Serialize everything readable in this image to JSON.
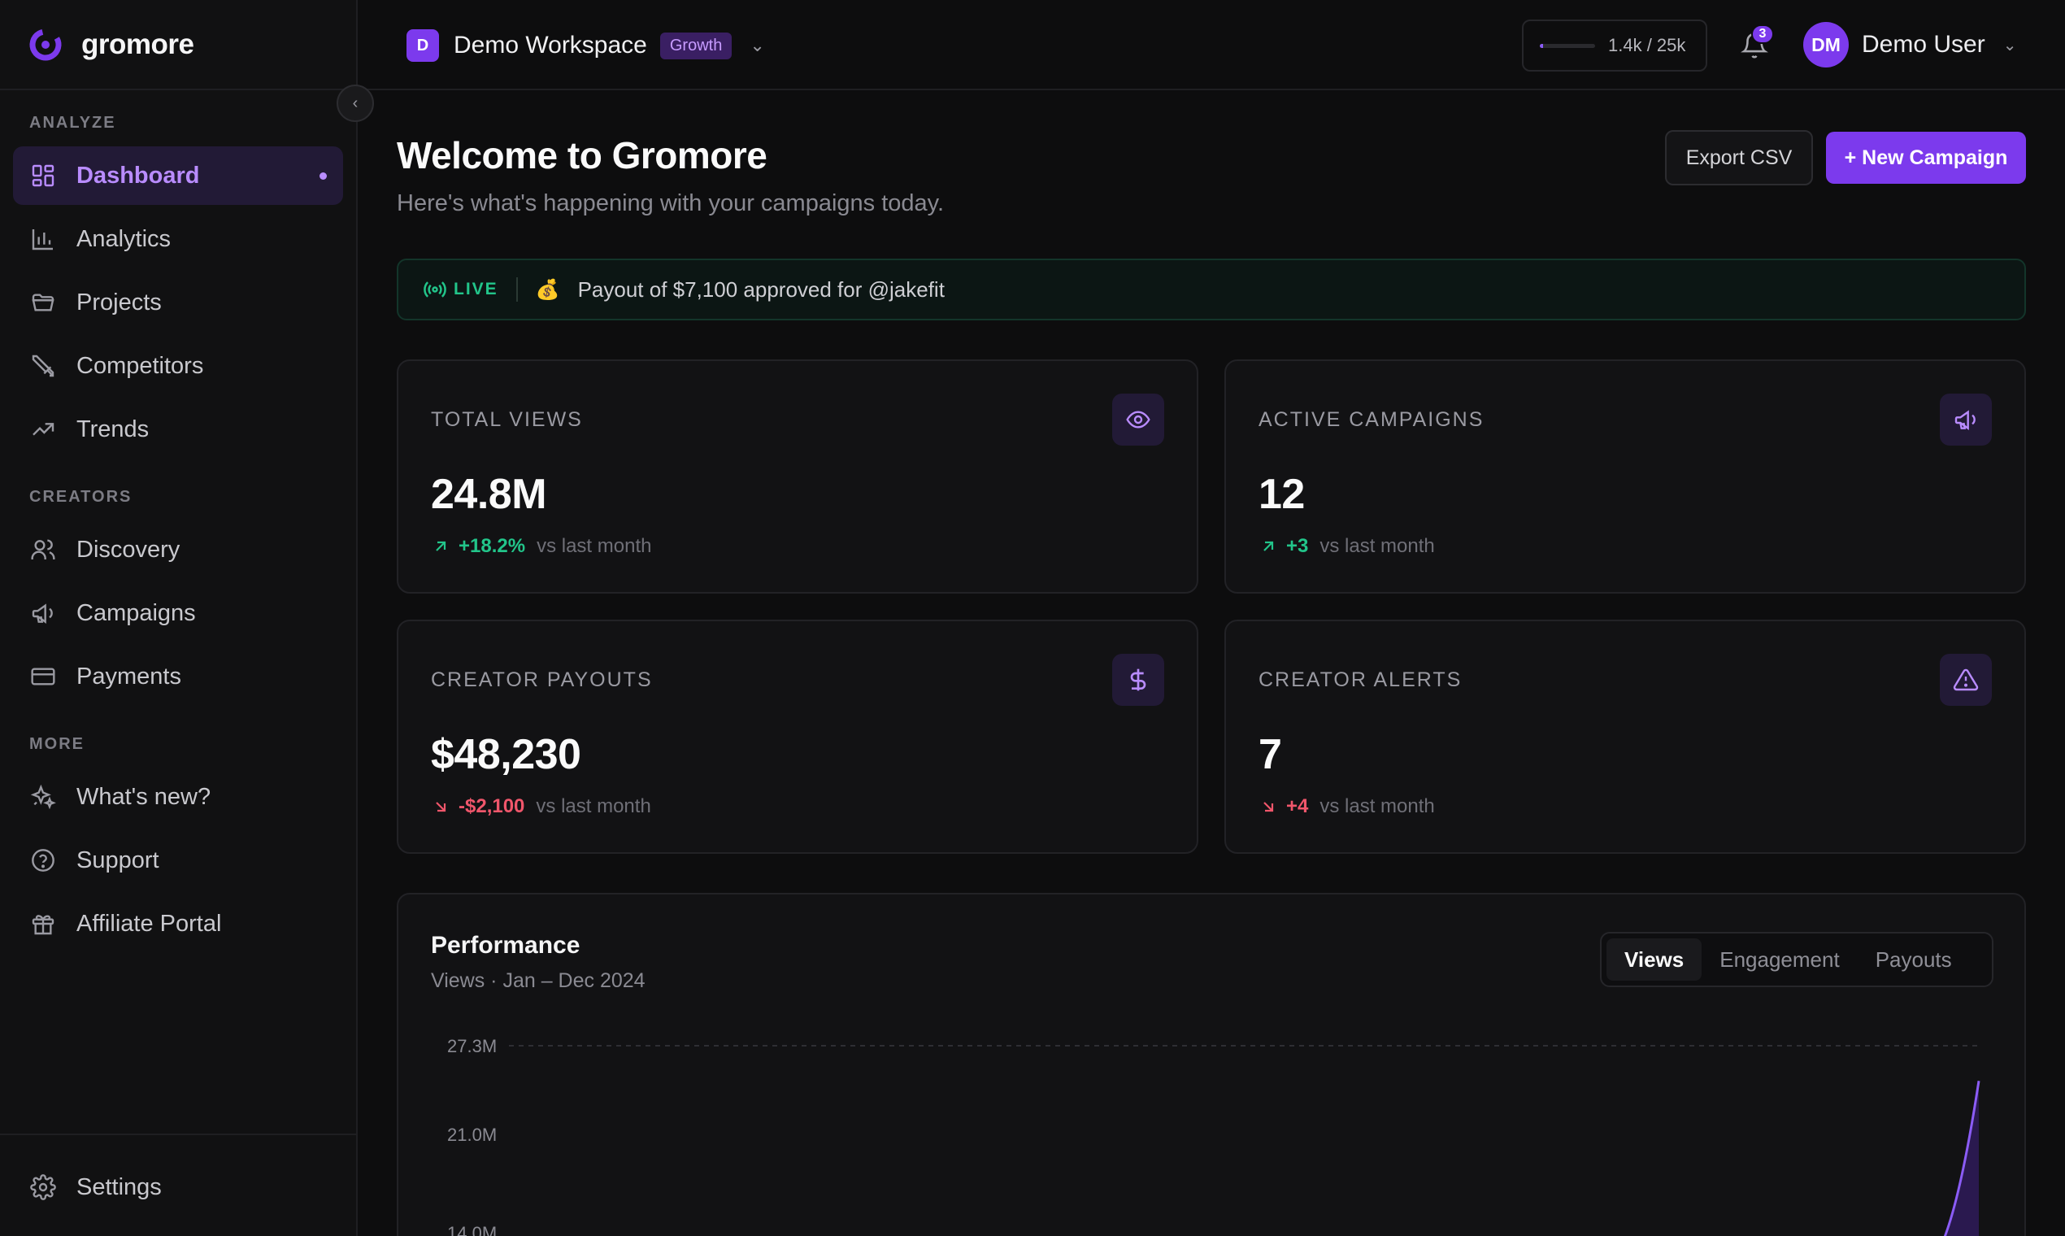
{
  "brand": {
    "name": "gromore"
  },
  "sidebar": {
    "sections": [
      {
        "label": "ANALYZE"
      },
      {
        "label": "CREATORS"
      },
      {
        "label": "MORE"
      }
    ],
    "items": [
      {
        "label": "Dashboard",
        "icon": "dashboard-icon",
        "active": true
      },
      {
        "label": "Analytics",
        "icon": "bar-chart-icon"
      },
      {
        "label": "Projects",
        "icon": "folder-icon"
      },
      {
        "label": "Competitors",
        "icon": "swords-icon"
      },
      {
        "label": "Trends",
        "icon": "trending-up-icon"
      },
      {
        "label": "Discovery",
        "icon": "users-icon"
      },
      {
        "label": "Campaigns",
        "icon": "megaphone-icon"
      },
      {
        "label": "Payments",
        "icon": "credit-card-icon"
      },
      {
        "label": "What's new?",
        "icon": "sparkles-icon"
      },
      {
        "label": "Support",
        "icon": "help-circle-icon"
      },
      {
        "label": "Affiliate Portal",
        "icon": "gift-icon"
      }
    ],
    "settings_label": "Settings"
  },
  "topbar": {
    "workspace_initial": "D",
    "workspace_name": "Demo Workspace",
    "plan_badge": "Growth",
    "usage_text": "1.4k / 25k",
    "usage_fraction": 0.056,
    "notification_count": "3",
    "user_initials": "DM",
    "user_name": "Demo User"
  },
  "header": {
    "title": "Welcome to Gromore",
    "subtitle": "Here's what's happening with your campaigns today.",
    "export_label": "Export CSV",
    "new_campaign_label": "+ New Campaign"
  },
  "live": {
    "label": "LIVE",
    "emoji": "💰",
    "text": "Payout of $7,100 approved for @jakefit"
  },
  "stats": [
    {
      "label": "TOTAL VIEWS",
      "value": "24.8M",
      "delta": "+18.2%",
      "trend": "up",
      "note": "vs last month",
      "icon": "eye-icon"
    },
    {
      "label": "ACTIVE CAMPAIGNS",
      "value": "12",
      "delta": "+3",
      "trend": "up",
      "note": "vs last month",
      "icon": "megaphone-icon"
    },
    {
      "label": "CREATOR PAYOUTS",
      "value": "$48,230",
      "delta": "-$2,100",
      "trend": "down",
      "note": "vs last month",
      "icon": "dollar-icon"
    },
    {
      "label": "CREATOR ALERTS",
      "value": "7",
      "delta": "+4",
      "trend": "down",
      "note": "vs last month",
      "icon": "alert-triangle-icon"
    }
  ],
  "performance": {
    "title": "Performance",
    "subtitle": "Views · Jan – Dec 2024",
    "tabs": [
      {
        "label": "Views",
        "active": true
      },
      {
        "label": "Engagement"
      },
      {
        "label": "Payouts"
      }
    ]
  },
  "chart_data": {
    "type": "area",
    "ytick_labels": [
      "27.3M",
      "21.0M",
      "14.0M"
    ],
    "yticks": [
      27.3,
      21.0,
      14.0
    ],
    "x": [
      11.55,
      12
    ],
    "values": [
      11.5,
      24.8
    ],
    "xlim": [
      1,
      12
    ],
    "ylim": [
      7,
      27.3
    ],
    "colors": {
      "line": "#8b5cf6",
      "fill": "#2d1b55"
    }
  },
  "colors": {
    "accent": "#7c3aed",
    "positive": "#22c58a",
    "negative": "#f0566b"
  }
}
